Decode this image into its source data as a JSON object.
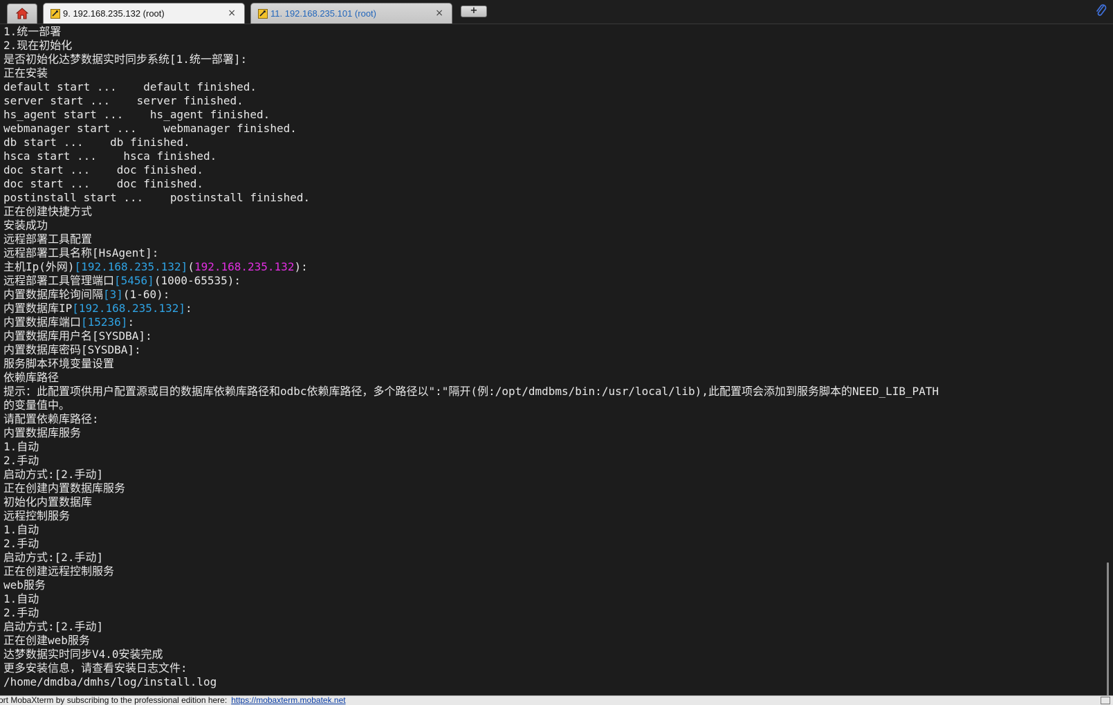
{
  "tabs": [
    {
      "label": "9. 192.168.235.132 (root)",
      "active": true
    },
    {
      "label": "11. 192.168.235.101 (root)",
      "active": false
    }
  ],
  "new_tab_label": "+",
  "close_glyph": "×",
  "colors": {
    "terminal_background": "#1c1c1c",
    "terminal_text": "#e8e8e8",
    "default_value": "#2fa3e4",
    "detected_value": "#e22ee2",
    "status_link": "#0a3ea8"
  },
  "icons": {
    "home": "home-icon",
    "session": "ssh-session-icon",
    "attach": "paperclip-icon"
  },
  "terminal": {
    "lines": [
      [
        {
          "text": "1.统一部署"
        }
      ],
      [
        {
          "text": "2.现在初始化"
        }
      ],
      [
        {
          "text": "是否初始化达梦数据实时同步系统[1.统一部署]:"
        }
      ],
      [
        {
          "text": "正在安装"
        }
      ],
      [
        {
          "text": "default start ...    default finished."
        }
      ],
      [
        {
          "text": "server start ...    server finished."
        }
      ],
      [
        {
          "text": "hs_agent start ...    hs_agent finished."
        }
      ],
      [
        {
          "text": "webmanager start ...    webmanager finished."
        }
      ],
      [
        {
          "text": "db start ...    db finished."
        }
      ],
      [
        {
          "text": "hsca start ...    hsca finished."
        }
      ],
      [
        {
          "text": "doc start ...    doc finished."
        }
      ],
      [
        {
          "text": "doc start ...    doc finished."
        }
      ],
      [
        {
          "text": "postinstall start ...    postinstall finished."
        }
      ],
      [
        {
          "text": "正在创建快捷方式"
        }
      ],
      [
        {
          "text": "安装成功"
        }
      ],
      [
        {
          "text": "远程部署工具配置"
        }
      ],
      [
        {
          "text": "远程部署工具名称[HsAgent]:"
        }
      ],
      [
        {
          "text": "主机Ip(外网)"
        },
        {
          "text": "[192.168.235.132]",
          "color": "blue"
        },
        {
          "text": "("
        },
        {
          "text": "192.168.235.132",
          "color": "magenta"
        },
        {
          "text": "):"
        }
      ],
      [
        {
          "text": "远程部署工具管理端口"
        },
        {
          "text": "[5456]",
          "color": "blue"
        },
        {
          "text": "(1000-65535):"
        }
      ],
      [
        {
          "text": "内置数据库轮询间隔"
        },
        {
          "text": "[3]",
          "color": "blue"
        },
        {
          "text": "(1-60):"
        }
      ],
      [
        {
          "text": "内置数据库IP"
        },
        {
          "text": "[192.168.235.132]",
          "color": "blue"
        },
        {
          "text": ":"
        }
      ],
      [
        {
          "text": "内置数据库端口"
        },
        {
          "text": "[15236]",
          "color": "blue"
        },
        {
          "text": ":"
        }
      ],
      [
        {
          "text": "内置数据库用户名[SYSDBA]:"
        }
      ],
      [
        {
          "text": "内置数据库密码[SYSDBA]:"
        }
      ],
      [
        {
          "text": "服务脚本环境变量设置"
        }
      ],
      [
        {
          "text": "依赖库路径"
        }
      ],
      [
        {
          "text": "提示：此配置项供用户配置源或目的数据库依赖库路径和odbc依赖库路径，多个路径以\":\"隔开(例:/opt/dmdbms/bin:/usr/local/lib),此配置项会添加到服务脚本的NEED_LIB_PATH"
        }
      ],
      [
        {
          "text": "的变量值中。"
        }
      ],
      [
        {
          "text": "请配置依赖库路径:"
        }
      ],
      [
        {
          "text": "内置数据库服务"
        }
      ],
      [
        {
          "text": "1.自动"
        }
      ],
      [
        {
          "text": "2.手动"
        }
      ],
      [
        {
          "text": "启动方式:[2.手动]"
        }
      ],
      [
        {
          "text": "正在创建内置数据库服务"
        }
      ],
      [
        {
          "text": "初始化内置数据库"
        }
      ],
      [
        {
          "text": "远程控制服务"
        }
      ],
      [
        {
          "text": "1.自动"
        }
      ],
      [
        {
          "text": "2.手动"
        }
      ],
      [
        {
          "text": "启动方式:[2.手动]"
        }
      ],
      [
        {
          "text": "正在创建远程控制服务"
        }
      ],
      [
        {
          "text": "web服务"
        }
      ],
      [
        {
          "text": "1.自动"
        }
      ],
      [
        {
          "text": "2.手动"
        }
      ],
      [
        {
          "text": "启动方式:[2.手动]"
        }
      ],
      [
        {
          "text": "正在创建web服务"
        }
      ],
      [
        {
          "text": "达梦数据实时同步V4.0安装完成"
        }
      ],
      [
        {
          "text": "更多安装信息，请查看安装日志文件:"
        }
      ],
      [
        {
          "text": "/home/dmdba/dmhs/log/install.log"
        }
      ]
    ]
  },
  "statusbar": {
    "text": "ort MobaXterm by subscribing to the professional edition here:",
    "link": "https://mobaxterm.mobatek.net"
  }
}
